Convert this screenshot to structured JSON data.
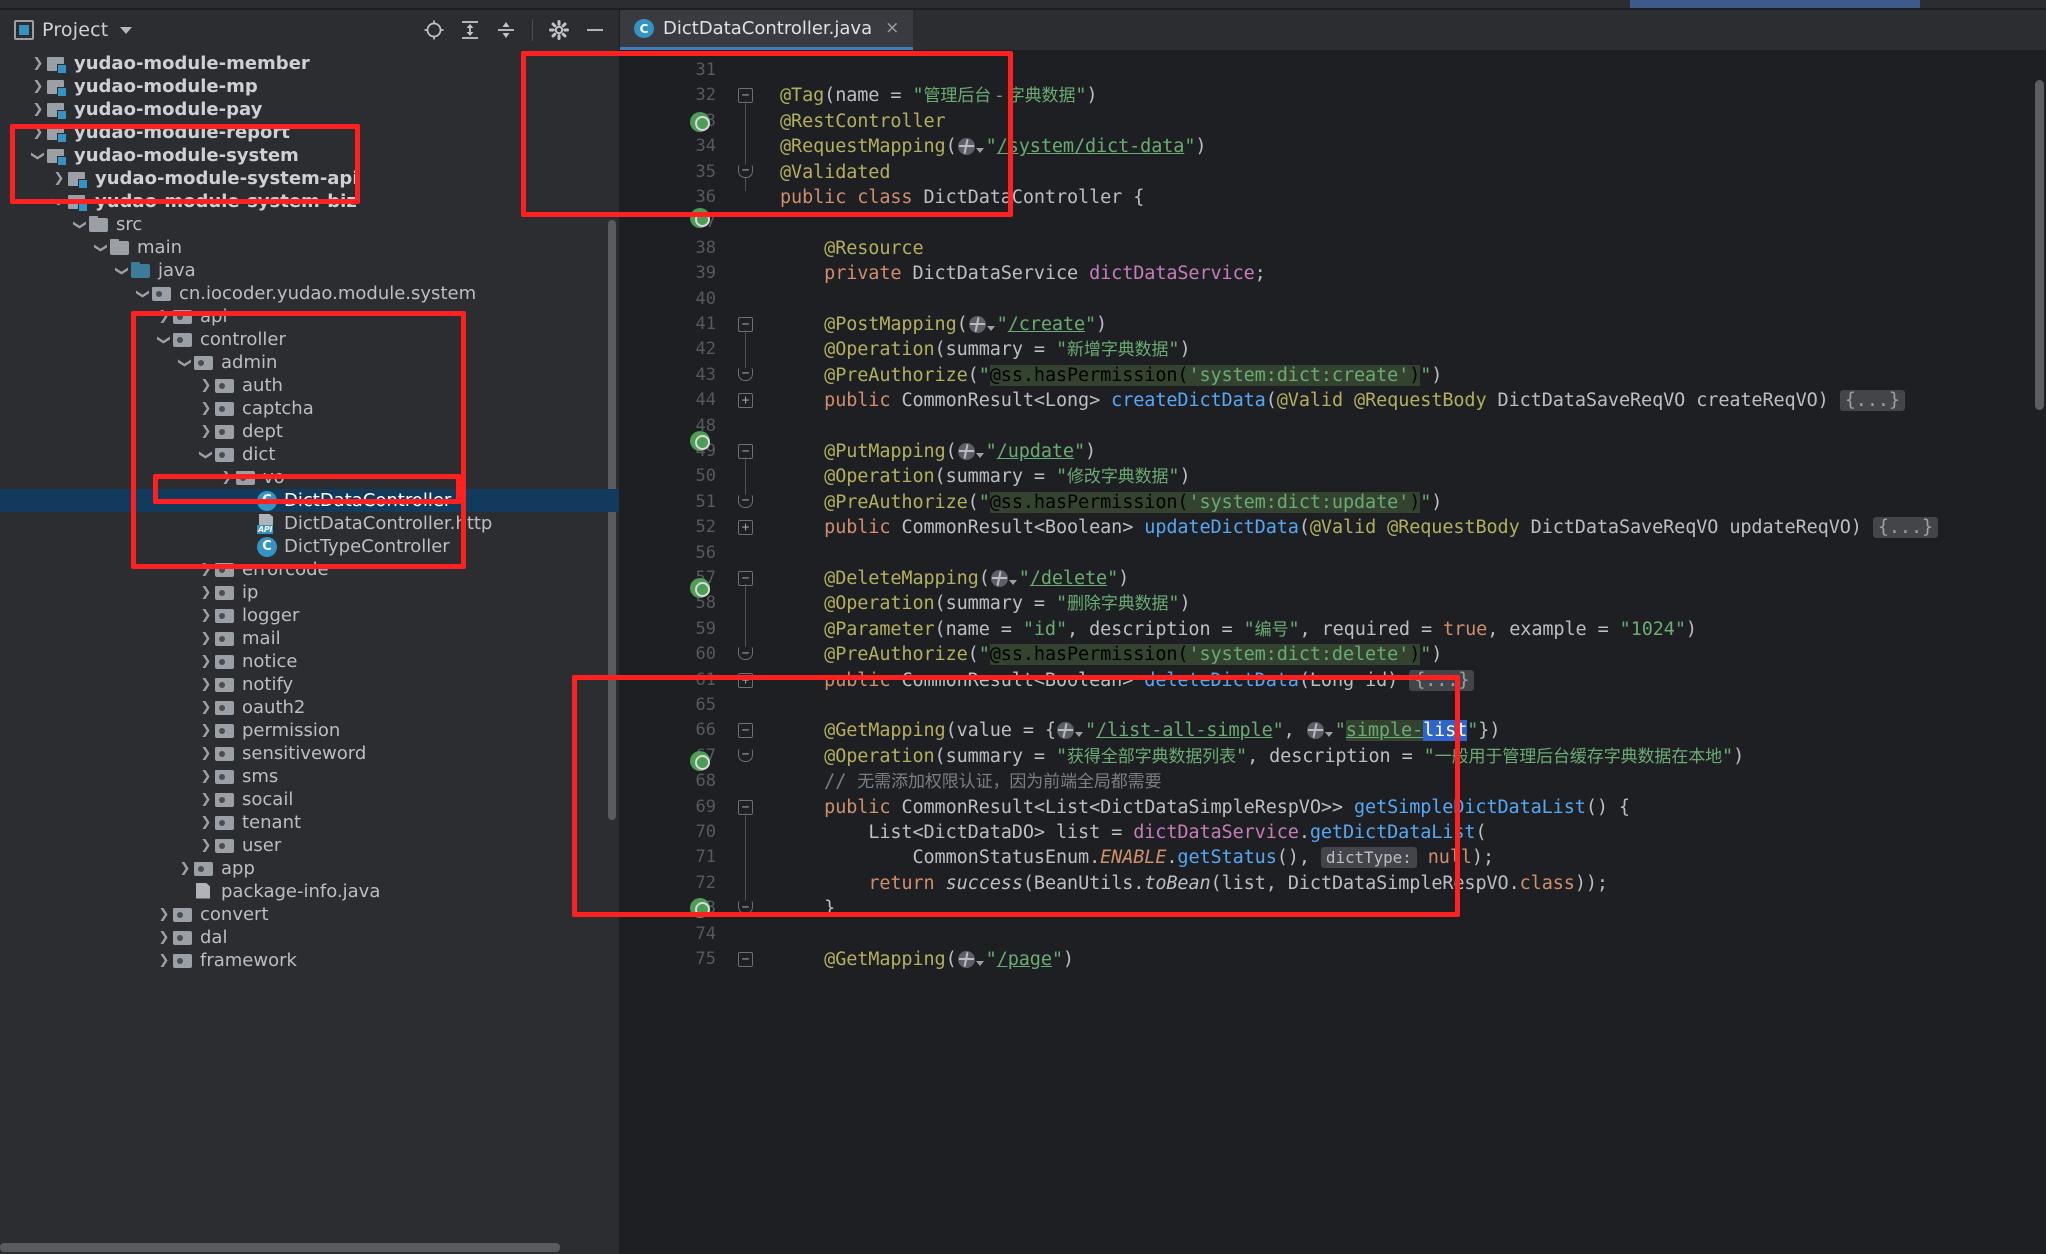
{
  "window": {
    "tool_window_title": "Project",
    "editor_tab_label": "DictDataController.java",
    "tab_close_icon": "×"
  },
  "toolbar": {
    "locate_icon": "locate-icon",
    "expand_all_icon": "expand-all-icon",
    "collapse_all_icon": "collapse-all-icon",
    "settings_icon": "gear-icon",
    "hide_icon": "minimize-icon"
  },
  "tree": {
    "items": [
      {
        "label": "yudao-module-member",
        "indent": 1,
        "twist": "collapsed",
        "icon": "module",
        "bold": true
      },
      {
        "label": "yudao-module-mp",
        "indent": 1,
        "twist": "collapsed",
        "icon": "module",
        "bold": true
      },
      {
        "label": "yudao-module-pay",
        "indent": 1,
        "twist": "collapsed",
        "icon": "module",
        "bold": true
      },
      {
        "label": "yudao-module-report",
        "indent": 1,
        "twist": "collapsed",
        "icon": "module",
        "bold": true
      },
      {
        "label": "yudao-module-system",
        "indent": 1,
        "twist": "expanded",
        "icon": "module",
        "bold": true
      },
      {
        "label": "yudao-module-system-api",
        "indent": 2,
        "twist": "collapsed",
        "icon": "module",
        "bold": true
      },
      {
        "label": "yudao-module-system-biz",
        "indent": 2,
        "twist": "expanded",
        "icon": "module",
        "bold": true
      },
      {
        "label": "src",
        "indent": 3,
        "twist": "expanded",
        "icon": "folder",
        "bold": false
      },
      {
        "label": "main",
        "indent": 4,
        "twist": "expanded",
        "icon": "folder",
        "bold": false
      },
      {
        "label": "java",
        "indent": 5,
        "twist": "expanded",
        "icon": "folder-blue",
        "bold": false
      },
      {
        "label": "cn.iocoder.yudao.module.system",
        "indent": 6,
        "twist": "expanded",
        "icon": "package",
        "bold": false
      },
      {
        "label": "api",
        "indent": 7,
        "twist": "collapsed",
        "icon": "package",
        "bold": false
      },
      {
        "label": "controller",
        "indent": 7,
        "twist": "expanded",
        "icon": "package",
        "bold": false
      },
      {
        "label": "admin",
        "indent": 8,
        "twist": "expanded",
        "icon": "package",
        "bold": false
      },
      {
        "label": "auth",
        "indent": 9,
        "twist": "collapsed",
        "icon": "package",
        "bold": false
      },
      {
        "label": "captcha",
        "indent": 9,
        "twist": "collapsed",
        "icon": "package",
        "bold": false
      },
      {
        "label": "dept",
        "indent": 9,
        "twist": "collapsed",
        "icon": "package",
        "bold": false
      },
      {
        "label": "dict",
        "indent": 9,
        "twist": "expanded",
        "icon": "package",
        "bold": false
      },
      {
        "label": "vo",
        "indent": 10,
        "twist": "collapsed",
        "icon": "package",
        "bold": false
      },
      {
        "label": "DictDataController",
        "indent": 11,
        "twist": "none",
        "icon": "class",
        "bold": false,
        "selected": true
      },
      {
        "label": "DictDataController.http",
        "indent": 11,
        "twist": "none",
        "icon": "http",
        "bold": false
      },
      {
        "label": "DictTypeController",
        "indent": 11,
        "twist": "none",
        "icon": "class",
        "bold": false
      },
      {
        "label": "errorcode",
        "indent": 9,
        "twist": "collapsed",
        "icon": "package",
        "bold": false
      },
      {
        "label": "ip",
        "indent": 9,
        "twist": "collapsed",
        "icon": "package",
        "bold": false
      },
      {
        "label": "logger",
        "indent": 9,
        "twist": "collapsed",
        "icon": "package",
        "bold": false
      },
      {
        "label": "mail",
        "indent": 9,
        "twist": "collapsed",
        "icon": "package",
        "bold": false
      },
      {
        "label": "notice",
        "indent": 9,
        "twist": "collapsed",
        "icon": "package",
        "bold": false
      },
      {
        "label": "notify",
        "indent": 9,
        "twist": "collapsed",
        "icon": "package",
        "bold": false
      },
      {
        "label": "oauth2",
        "indent": 9,
        "twist": "collapsed",
        "icon": "package",
        "bold": false
      },
      {
        "label": "permission",
        "indent": 9,
        "twist": "collapsed",
        "icon": "package",
        "bold": false
      },
      {
        "label": "sensitiveword",
        "indent": 9,
        "twist": "collapsed",
        "icon": "package",
        "bold": false
      },
      {
        "label": "sms",
        "indent": 9,
        "twist": "collapsed",
        "icon": "package",
        "bold": false
      },
      {
        "label": "socail",
        "indent": 9,
        "twist": "collapsed",
        "icon": "package",
        "bold": false
      },
      {
        "label": "tenant",
        "indent": 9,
        "twist": "collapsed",
        "icon": "package",
        "bold": false
      },
      {
        "label": "user",
        "indent": 9,
        "twist": "collapsed",
        "icon": "package",
        "bold": false
      },
      {
        "label": "app",
        "indent": 8,
        "twist": "collapsed",
        "icon": "package",
        "bold": false
      },
      {
        "label": "package-info.java",
        "indent": 8,
        "twist": "none",
        "icon": "javafile",
        "bold": false
      },
      {
        "label": "convert",
        "indent": 7,
        "twist": "collapsed",
        "icon": "package",
        "bold": false
      },
      {
        "label": "dal",
        "indent": 7,
        "twist": "collapsed",
        "icon": "package",
        "bold": false
      },
      {
        "label": "framework",
        "indent": 7,
        "twist": "collapsed",
        "icon": "package",
        "bold": false
      }
    ]
  },
  "editor": {
    "lines": [
      {
        "no": "31",
        "text": ""
      },
      {
        "no": "32",
        "text": "@Tag(name = \"管理后台 - 字典数据\")"
      },
      {
        "no": "33",
        "text": "@RestController"
      },
      {
        "no": "34",
        "text": "@RequestMapping(\"/system/dict-data\")"
      },
      {
        "no": "35",
        "text": "@Validated"
      },
      {
        "no": "36",
        "text": "public class DictDataController {"
      },
      {
        "no": "37",
        "text": ""
      },
      {
        "no": "38",
        "text": "    @Resource"
      },
      {
        "no": "39",
        "text": "    private DictDataService dictDataService;"
      },
      {
        "no": "40",
        "text": ""
      },
      {
        "no": "41",
        "text": "    @PostMapping(\"/create\")"
      },
      {
        "no": "42",
        "text": "    @Operation(summary = \"新增字典数据\")"
      },
      {
        "no": "43",
        "text": "    @PreAuthorize(\"@ss.hasPermission('system:dict:create')\")"
      },
      {
        "no": "44",
        "text": "    public CommonResult<Long> createDictData(@Valid @RequestBody DictDataSaveReqVO createReqVO) {...}"
      },
      {
        "no": "48",
        "text": ""
      },
      {
        "no": "49",
        "text": "    @PutMapping(\"/update\")"
      },
      {
        "no": "50",
        "text": "    @Operation(summary = \"修改字典数据\")"
      },
      {
        "no": "51",
        "text": "    @PreAuthorize(\"@ss.hasPermission('system:dict:update')\")"
      },
      {
        "no": "52",
        "text": "    public CommonResult<Boolean> updateDictData(@Valid @RequestBody DictDataSaveReqVO updateReqVO) {...}"
      },
      {
        "no": "56",
        "text": ""
      },
      {
        "no": "57",
        "text": "    @DeleteMapping(\"/delete\")"
      },
      {
        "no": "58",
        "text": "    @Operation(summary = \"删除字典数据\")"
      },
      {
        "no": "59",
        "text": "    @Parameter(name = \"id\", description = \"编号\", required = true, example = \"1024\")"
      },
      {
        "no": "60",
        "text": "    @PreAuthorize(\"@ss.hasPermission('system:dict:delete')\")"
      },
      {
        "no": "61",
        "text": "    public CommonResult<Boolean> deleteDictData(Long id) {...}"
      },
      {
        "no": "65",
        "text": ""
      },
      {
        "no": "66",
        "text": "    @GetMapping(value = {\"/list-all-simple\", \"simple-list\"})"
      },
      {
        "no": "67",
        "text": "    @Operation(summary = \"获得全部字典数据列表\", description = \"一般用于管理后台缓存字典数据在本地\")"
      },
      {
        "no": "68",
        "text": "    // 无需添加权限认证，因为前端全局都需要"
      },
      {
        "no": "69",
        "text": "    public CommonResult<List<DictDataSimpleRespVO>> getSimpleDictDataList() {"
      },
      {
        "no": "70",
        "text": "        List<DictDataDO> list = dictDataService.getDictDataList("
      },
      {
        "no": "71",
        "text": "                CommonStatusEnum.ENABLE.getStatus(),  dictType: null);"
      },
      {
        "no": "72",
        "text": "        return success(BeanUtils.toBean(list, DictDataSimpleRespVO.class));"
      },
      {
        "no": "73",
        "text": "    }"
      },
      {
        "no": "74",
        "text": ""
      },
      {
        "no": "75",
        "text": "    @GetMapping(\"/page\")"
      }
    ],
    "inlay_hints": [
      "dictType:"
    ],
    "selection_text": "list",
    "mapping_paths": [
      "/system/dict-data",
      "/create",
      "/update",
      "/delete",
      "/list-all-simple",
      "simple-list",
      "/page"
    ],
    "folded_placeholder": "{...}"
  },
  "annotations": {
    "boxes": [
      {
        "name": "module-system-highlight"
      },
      {
        "name": "controller-package-highlight"
      },
      {
        "name": "dictdatacontroller-file-highlight"
      },
      {
        "name": "class-declaration-highlight"
      },
      {
        "name": "simple-list-method-highlight"
      }
    ]
  },
  "colors": {
    "accent_red": "#ff2020",
    "selection_blue": "#113a5c",
    "tab_underline": "#3c7ebf",
    "keyword": "#cf8e6d",
    "annotation": "#b3ae60",
    "string": "#6aab73",
    "method": "#56a8f5",
    "field": "#c77dbb",
    "comment": "#7a7e85"
  }
}
